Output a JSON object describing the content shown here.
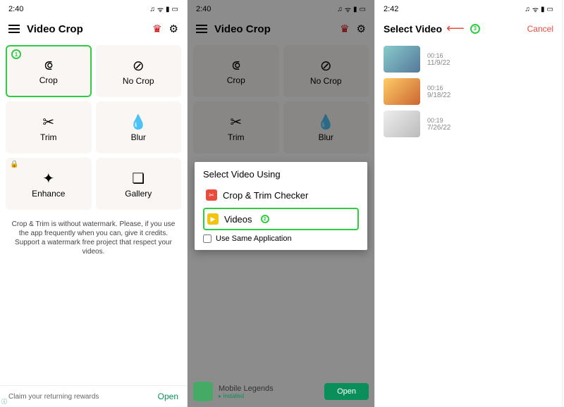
{
  "screen1": {
    "time": "2:40",
    "app_title": "Video Crop",
    "tiles": [
      {
        "label": "Crop",
        "icon": "⟃"
      },
      {
        "label": "No Crop",
        "icon": "⊘"
      },
      {
        "label": "Trim",
        "icon": "✂"
      },
      {
        "label": "Blur",
        "icon": "💧"
      },
      {
        "label": "Enhance",
        "icon": "✦",
        "locked": true
      },
      {
        "label": "Gallery",
        "icon": "❏"
      }
    ],
    "footnote": "Crop & Trim is without watermark. Please, if you use the app frequently when you can, give it credits. Support a watermark free project that respect your videos.",
    "ad_text": "Claim your returning rewards",
    "ad_open": "Open",
    "badge1": "1"
  },
  "screen2": {
    "time": "2:40",
    "app_title": "Video Crop",
    "dialog_title": "Select Video Using",
    "option1": "Crop & Trim Checker",
    "option2": "Videos",
    "checkbox_label": "Use Same Application",
    "ad_name": "Mobile Legends",
    "ad_status": "▸ Installed",
    "ad_open": "Open",
    "badge2": "2"
  },
  "screen3": {
    "time": "2:42",
    "title": "Select Video",
    "cancel": "Cancel",
    "badge3": "3",
    "videos": [
      {
        "duration": "00:16",
        "date": "11/9/22"
      },
      {
        "duration": "00:16",
        "date": "9/18/22"
      },
      {
        "duration": "00:19",
        "date": "7/26/22"
      }
    ]
  }
}
